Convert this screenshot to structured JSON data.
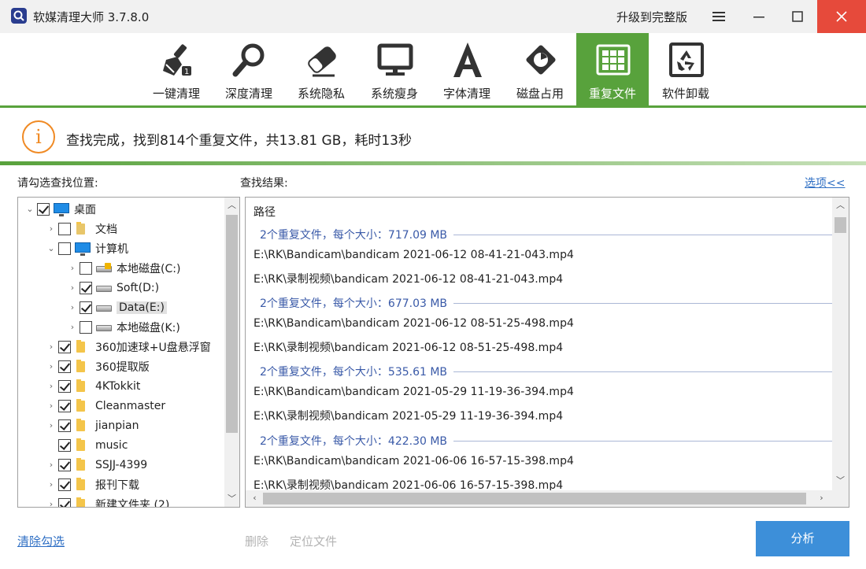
{
  "window": {
    "title": "软媒清理大师 3.7.8.0",
    "upgrade_label": "升级到完整版"
  },
  "toolbar": {
    "items": [
      {
        "label": "一键清理",
        "icon": "broom-icon"
      },
      {
        "label": "深度清理",
        "icon": "magnifier-icon"
      },
      {
        "label": "系统隐私",
        "icon": "eraser-icon"
      },
      {
        "label": "系统瘦身",
        "icon": "monitor-icon"
      },
      {
        "label": "字体清理",
        "icon": "font-icon"
      },
      {
        "label": "磁盘占用",
        "icon": "disk-usage-icon"
      },
      {
        "label": "重复文件",
        "icon": "duplicate-files-icon",
        "active": true
      },
      {
        "label": "软件卸载",
        "icon": "recycle-icon"
      }
    ]
  },
  "status": {
    "message": "查找完成，找到814个重复文件，共13.81 GB，耗时13秒"
  },
  "left_panel": {
    "title": "请勾选查找位置:",
    "tree": [
      {
        "label": "桌面",
        "checked": true,
        "icon": "desktop-icon",
        "expanded": true
      },
      {
        "label": "文档",
        "checked": false,
        "icon": "documents-icon"
      },
      {
        "label": "计算机",
        "checked": false,
        "icon": "computer-icon",
        "expanded": true
      },
      {
        "label": "本地磁盘(C:)",
        "checked": false,
        "icon": "system-drive-icon"
      },
      {
        "label": "Soft(D:)",
        "checked": true,
        "icon": "drive-icon"
      },
      {
        "label": "Data(E:)",
        "checked": true,
        "icon": "drive-icon",
        "selected": true
      },
      {
        "label": "本地磁盘(K:)",
        "checked": false,
        "icon": "drive-icon"
      },
      {
        "label": "360加速球+U盘悬浮窗",
        "checked": true,
        "icon": "folder-icon"
      },
      {
        "label": "360提取版",
        "checked": true,
        "icon": "folder-icon"
      },
      {
        "label": "4KTokkit",
        "checked": true,
        "icon": "folder-icon"
      },
      {
        "label": "Cleanmaster",
        "checked": true,
        "icon": "folder-icon"
      },
      {
        "label": "jianpian",
        "checked": true,
        "icon": "folder-icon"
      },
      {
        "label": "music",
        "checked": true,
        "icon": "folder-icon"
      },
      {
        "label": "SSJJ-4399",
        "checked": true,
        "icon": "folder-icon"
      },
      {
        "label": "报刊下载",
        "checked": true,
        "icon": "folder-icon"
      },
      {
        "label": "新建文件夹 (2)",
        "checked": true,
        "icon": "folder-icon"
      }
    ]
  },
  "right_panel": {
    "title": "查找结果:",
    "options_link": "选项<<",
    "column_header": "路径",
    "groups": [
      {
        "summary": "2个重复文件，每个大小：717.09 MB",
        "files": [
          "E:\\RK\\Bandicam\\bandicam 2021-06-12 08-41-21-043.mp4",
          "E:\\RK\\录制视频\\bandicam 2021-06-12 08-41-21-043.mp4"
        ]
      },
      {
        "summary": "2个重复文件，每个大小：677.03 MB",
        "files": [
          "E:\\RK\\Bandicam\\bandicam 2021-06-12 08-51-25-498.mp4",
          "E:\\RK\\录制视频\\bandicam 2021-06-12 08-51-25-498.mp4"
        ]
      },
      {
        "summary": "2个重复文件，每个大小：535.61 MB",
        "files": [
          "E:\\RK\\Bandicam\\bandicam 2021-05-29 11-19-36-394.mp4",
          "E:\\RK\\录制视频\\bandicam 2021-05-29 11-19-36-394.mp4"
        ]
      },
      {
        "summary": "2个重复文件，每个大小：422.30 MB",
        "files": [
          "E:\\RK\\Bandicam\\bandicam 2021-06-06 16-57-15-398.mp4",
          "E:\\RK\\录制视频\\bandicam 2021-06-06 16-57-15-398.mp4"
        ]
      }
    ]
  },
  "bottom": {
    "clear_label": "清除勾选",
    "delete_label": "删除",
    "locate_label": "定位文件",
    "analyze_label": "分析"
  },
  "colors": {
    "accent_green": "#58a23c",
    "status_orange": "#f08a24",
    "link_blue": "#2f6fc4",
    "button_blue": "#3d8fd9",
    "close_red": "#e64a3b"
  }
}
